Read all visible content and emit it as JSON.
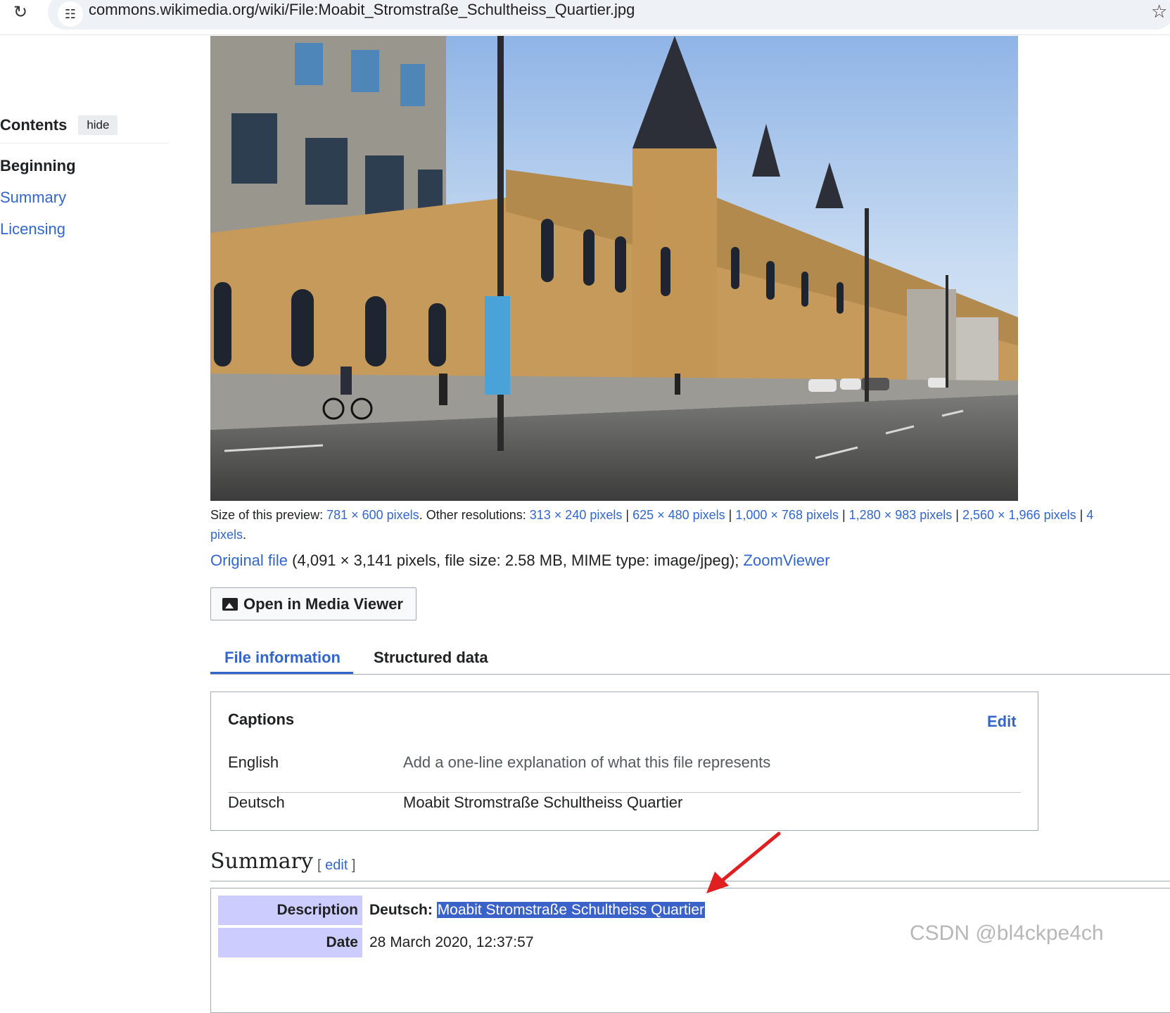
{
  "browser": {
    "url": "commons.wikimedia.org/wiki/File:Moabit_Stromstraße_Schultheiss_Quartier.jpg"
  },
  "toc": {
    "title": "Contents",
    "hide_label": "hide",
    "items": [
      {
        "label": "Beginning"
      },
      {
        "label": "Summary"
      },
      {
        "label": "Licensing"
      }
    ]
  },
  "preview": {
    "size_label": "Size of this preview: ",
    "size_value": "781 × 600 pixels",
    "other_label": ". Other resolutions: ",
    "resolutions": [
      "313 × 240 pixels",
      "625 × 480 pixels",
      "1,000 × 768 pixels",
      "1,280 × 983 pixels",
      "2,560 × 1,966 pixels"
    ],
    "separator": " | ",
    "trailing_fragment": "4",
    "wrap_text": "pixels",
    "wrap_period": "."
  },
  "original": {
    "link_label": "Original file",
    "details": " (4,091 × 3,141 pixels, file size: 2.58 MB, MIME type: image/jpeg); ",
    "zoom_label": "ZoomViewer"
  },
  "media_viewer_button": "Open in Media Viewer",
  "tabs": [
    {
      "label": "File information"
    },
    {
      "label": "Structured data"
    }
  ],
  "captions": {
    "title": "Captions",
    "edit_label": "Edit",
    "rows": [
      {
        "lang": "English",
        "value": "Add a one-line explanation of what this file represents"
      },
      {
        "lang": "Deutsch",
        "value": "Moabit Stromstraße Schultheiss Quartier"
      }
    ]
  },
  "summary": {
    "title": "Summary",
    "edit_open": "[ ",
    "edit_label": "edit",
    "edit_close": " ]",
    "rows": [
      {
        "label": "Description",
        "prefix": "Deutsch: ",
        "value": "Moabit Stromstraße Schultheiss Quartier"
      },
      {
        "label": "Date",
        "prefix": "",
        "value": "28 March 2020, 12:37:57"
      }
    ]
  },
  "watermark": "CSDN @bl4ckpe4ch",
  "colors": {
    "link": "#3366cc",
    "label_bg": "#ccccff",
    "highlight": "#3a62c8",
    "arrow": "#e02020"
  }
}
